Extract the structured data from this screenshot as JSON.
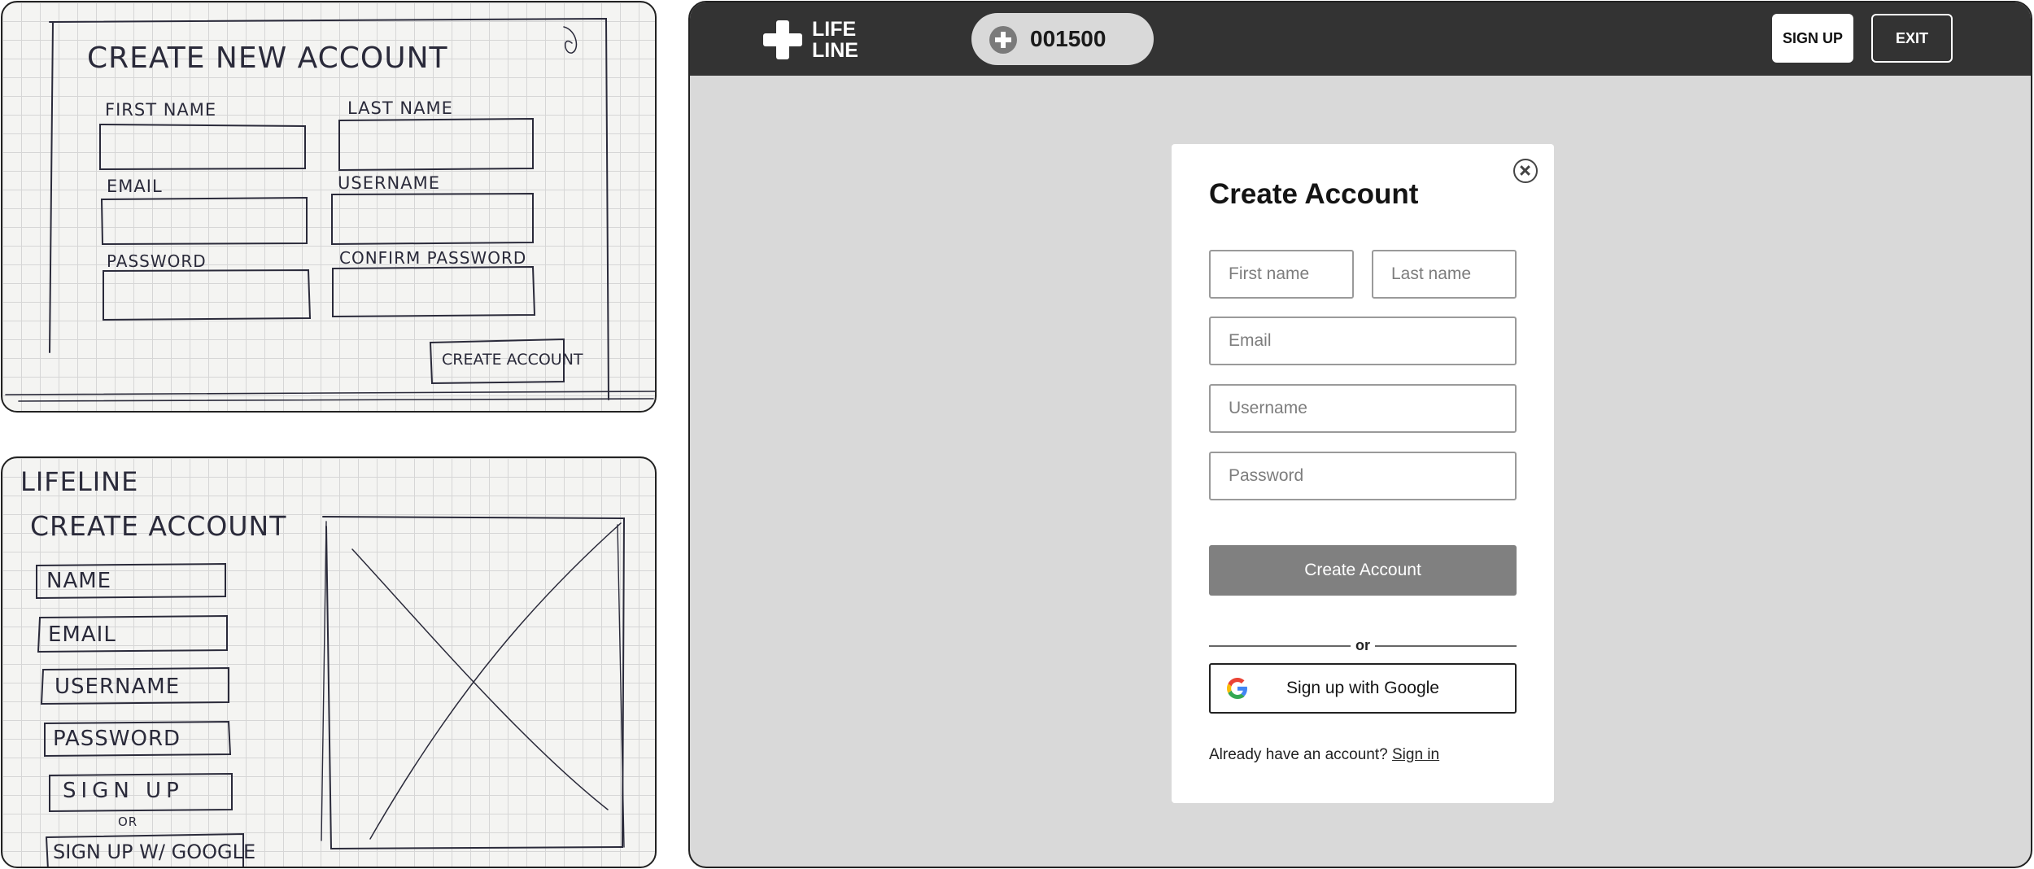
{
  "sketch_top": {
    "title": "CREATE NEW ACCOUNT",
    "labels": {
      "first_name": "FIRST NAME",
      "last_name": "LAST NAME",
      "email": "EMAIL",
      "username": "USERNAME",
      "password": "PASSWORD",
      "confirm_password": "CONFIRM PASSWORD"
    },
    "button": "CREATE ACCOUNT"
  },
  "sketch_bottom": {
    "brand": "LIFELINE",
    "title": "CREATE ACCOUNT",
    "fields": [
      "NAME",
      "EMAIL",
      "USERNAME",
      "PASSWORD"
    ],
    "signup_button": "SIGN UP",
    "or": "OR",
    "google_button": "SIGN UP W/ GOOGLE"
  },
  "header": {
    "logo_line1": "LIFE",
    "logo_line2": "LINE",
    "points": "001500",
    "signup_label": "SIGN UP",
    "exit_label": "EXIT"
  },
  "modal": {
    "title": "Create Account",
    "first_name_placeholder": "First name",
    "last_name_placeholder": "Last name",
    "email_placeholder": "Email",
    "username_placeholder": "Username",
    "password_placeholder": "Password",
    "create_button": "Create Account",
    "or": "or",
    "google_button": "Sign up with Google",
    "already_text": "Already have an account?",
    "signin_link": "Sign in"
  }
}
